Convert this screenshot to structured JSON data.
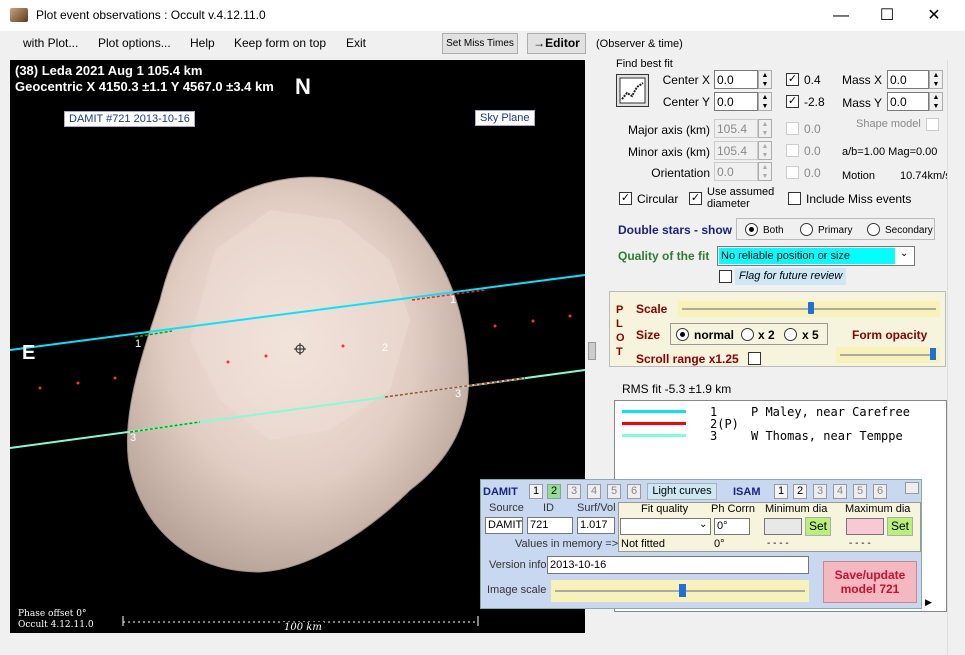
{
  "window": {
    "title": "Plot event observations : Occult v.4.12.11.0",
    "minimize": "—",
    "maximize": "☐",
    "close": "✕"
  },
  "menu": {
    "items": [
      "with Plot...",
      "Plot options...",
      "Help",
      "Keep form on top",
      "Exit"
    ],
    "set_miss_times": "Set Miss Times",
    "editor": "→Editor",
    "observer_time": "(Observer & time)"
  },
  "plot": {
    "line1": "(38) Leda  2021 Aug 1   105.4 km",
    "line2": "Geocentric  X 4150.3 ±1.1  Y 4567.0 ±3.4 km",
    "north": "N",
    "east": "E",
    "damit_tag": "DAMIT #721 2013-10-16",
    "sky_plane": "Sky Plane",
    "phase_offset": "Phase offset 0°",
    "version": "Occult 4.12.11.0",
    "scale_label": "100 km",
    "chord_labels": [
      "1",
      "3",
      "1",
      "2",
      "3"
    ]
  },
  "fit": {
    "find_best_fit": "Find best fit",
    "center_x_label": "Center X",
    "center_x": "0.0",
    "center_x_step": "0.4",
    "center_y_label": "Center Y",
    "center_y": "0.0",
    "center_y_step": "-2.8",
    "mass_x_label": "Mass X",
    "mass_x": "0.0",
    "mass_y_label": "Mass Y",
    "mass_y": "0.0",
    "shape_model": "Shape model",
    "major_axis_label": "Major axis (km)",
    "major_axis": "105.4",
    "minor_axis_label": "Minor axis (km)",
    "minor_axis": "105.4",
    "orientation_label": "Orientation",
    "orientation": "0.0",
    "disabled_step": "0.0",
    "ab_ratio": "a/b=1.00  Mag=0.00",
    "motion_label": "Motion",
    "motion": "10.74km/s",
    "circular": "Circular",
    "use_assumed": "Use assumed diameter",
    "include_miss": "Include Miss events",
    "double_stars": "Double stars - show",
    "both": "Both",
    "primary": "Primary",
    "secondary": "Secondary",
    "quality_label": "Quality of the fit",
    "quality_value": "No reliable position or size",
    "flag_review": "Flag for future review"
  },
  "plot_panel": {
    "plot_vert": [
      "P",
      "L",
      "O",
      "T"
    ],
    "scale": "Scale",
    "size": "Size",
    "normal": "normal",
    "x2": "x 2",
    "x5": "x 5",
    "form_opacity": "Form opacity",
    "scroll_range": "Scroll range x1.25"
  },
  "rms": "RMS fit  -5.3 ±1.9 km",
  "legend": [
    {
      "num": "1",
      "name": "P Maley, near Carefree",
      "color": "#00ffff"
    },
    {
      "num": "2(P)",
      "name": "",
      "color": "#ff0000"
    },
    {
      "num": "3",
      "name": "W Thomas, near Temppe",
      "color": "#7fffd4"
    }
  ],
  "damit": {
    "damit_label": "DAMIT",
    "damit_nums": [
      "1",
      "2",
      "3",
      "4",
      "5",
      "6"
    ],
    "light_curves": "Light curves",
    "isam_label": "ISAM",
    "isam_nums": [
      "1",
      "2",
      "3",
      "4",
      "5",
      "6"
    ],
    "source_label": "Source",
    "id_label": "ID",
    "surfvol_label": "Surf/Vol",
    "source": "DAMIT",
    "id": "721",
    "surfvol": "1.017",
    "fit_quality": "Fit quality",
    "ph_corr": "Ph Corrn",
    "ph_corr_value": "0°",
    "min_dia": "Minimum dia",
    "max_dia": "Maximum dia",
    "set": "Set",
    "values_in_memory": "Values in memory =>",
    "not_fitted": "Not fitted",
    "mem_ph": "0°",
    "mem_min": "- - - -",
    "mem_max": "- - - -",
    "version_label": "Version info",
    "version": "2013-10-16",
    "image_scale": "Image scale",
    "save_update": "Save/update model 721"
  },
  "colors": {
    "chord1": "#00e5ff",
    "chord3": "#7fffd4",
    "asteroid": "#e8d2c8",
    "save_bg": "#f4b8c0",
    "save_fg": "#c8102e",
    "dark_blue": "#1a237e",
    "dark_red": "#8b0000",
    "green": "#2e7d32"
  }
}
